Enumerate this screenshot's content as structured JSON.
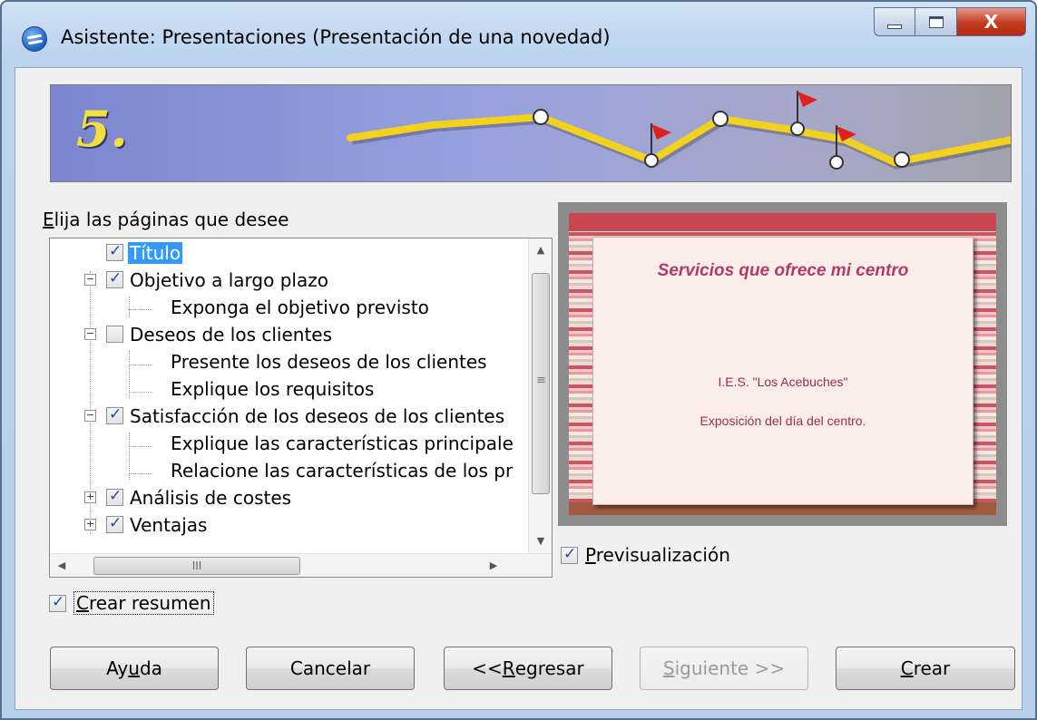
{
  "window": {
    "title": "Asistente: Presentaciones (Presentación de una novedad)",
    "close_glyph": "X"
  },
  "banner": {
    "step": "5."
  },
  "pages": {
    "label_prefix": "E",
    "label_rest": "lija las páginas que desee",
    "items": [
      {
        "label": "Título",
        "checked": true,
        "selected": true
      },
      {
        "label": "Objetivo a largo plazo",
        "checked": true,
        "expander": "−"
      },
      {
        "label": "Exponga el objetivo previsto"
      },
      {
        "label": "Deseos de los clientes",
        "checked": false,
        "expander": "−"
      },
      {
        "label": "Presente los deseos de los clientes"
      },
      {
        "label": "Explique los requisitos"
      },
      {
        "label": "Satisfacción de los deseos de los clientes",
        "checked": true,
        "expander": "−"
      },
      {
        "label": "Explique las características principale"
      },
      {
        "label": "Relacione las características de los pr"
      },
      {
        "label": "Análisis de costes",
        "checked": true,
        "expander": "+"
      },
      {
        "label": "Ventajas",
        "checked": true,
        "expander": "+"
      }
    ],
    "hscroll_grip": "III"
  },
  "summary": {
    "prefix": "C",
    "rest": "rear resumen",
    "checked": true
  },
  "preview": {
    "toggle_prefix": "P",
    "toggle_rest": "revisualización",
    "checked": true,
    "slide_title": "Servicios que ofrece mi centro",
    "slide_line1": "I.E.S. \"Los Acebuches\"",
    "slide_line2": "Exposición del día del centro."
  },
  "buttons": {
    "help_a": "Ay",
    "help_u": "u",
    "help_b": "da",
    "cancel": "Cancelar",
    "back_a": "<< ",
    "back_u": "R",
    "back_b": "egresar",
    "next_u": "S",
    "next_b": "iguiente >>",
    "create_u": "C",
    "create_b": "rear"
  },
  "colors": {
    "accent": "#3399ff",
    "banner_number": "#f0e040",
    "slide_title": "#b23a6a"
  }
}
